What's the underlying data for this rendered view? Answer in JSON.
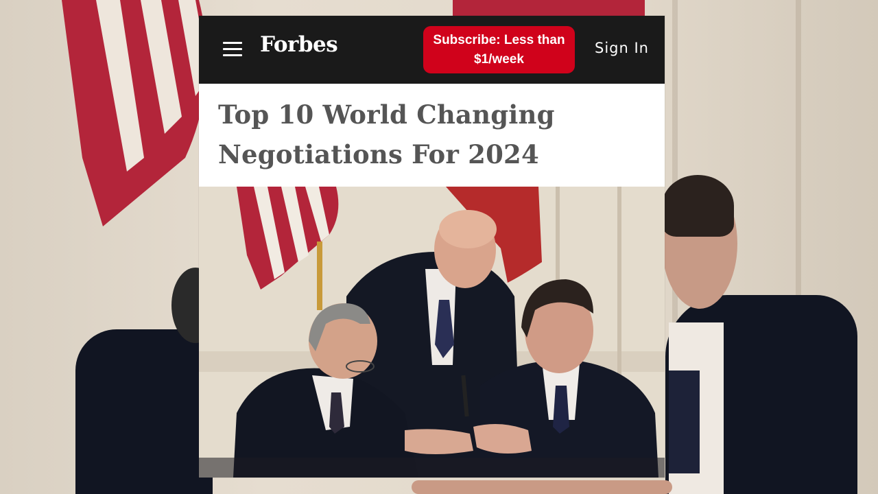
{
  "header": {
    "menu_icon": "hamburger-menu-icon",
    "logo_text": "Forbes",
    "subscribe_label": "Subscribe: Less than $1/week",
    "signin_label": "Sign In"
  },
  "article": {
    "title": "Top 10 World Changing Negotiations For 2024",
    "image_alt": "Two statesmen shaking hands at a signing table while a man leans over between them, flags in background"
  },
  "colors": {
    "header_bg": "#1a1a1a",
    "subscribe_bg": "#d0021b",
    "headline_text": "#555555"
  }
}
